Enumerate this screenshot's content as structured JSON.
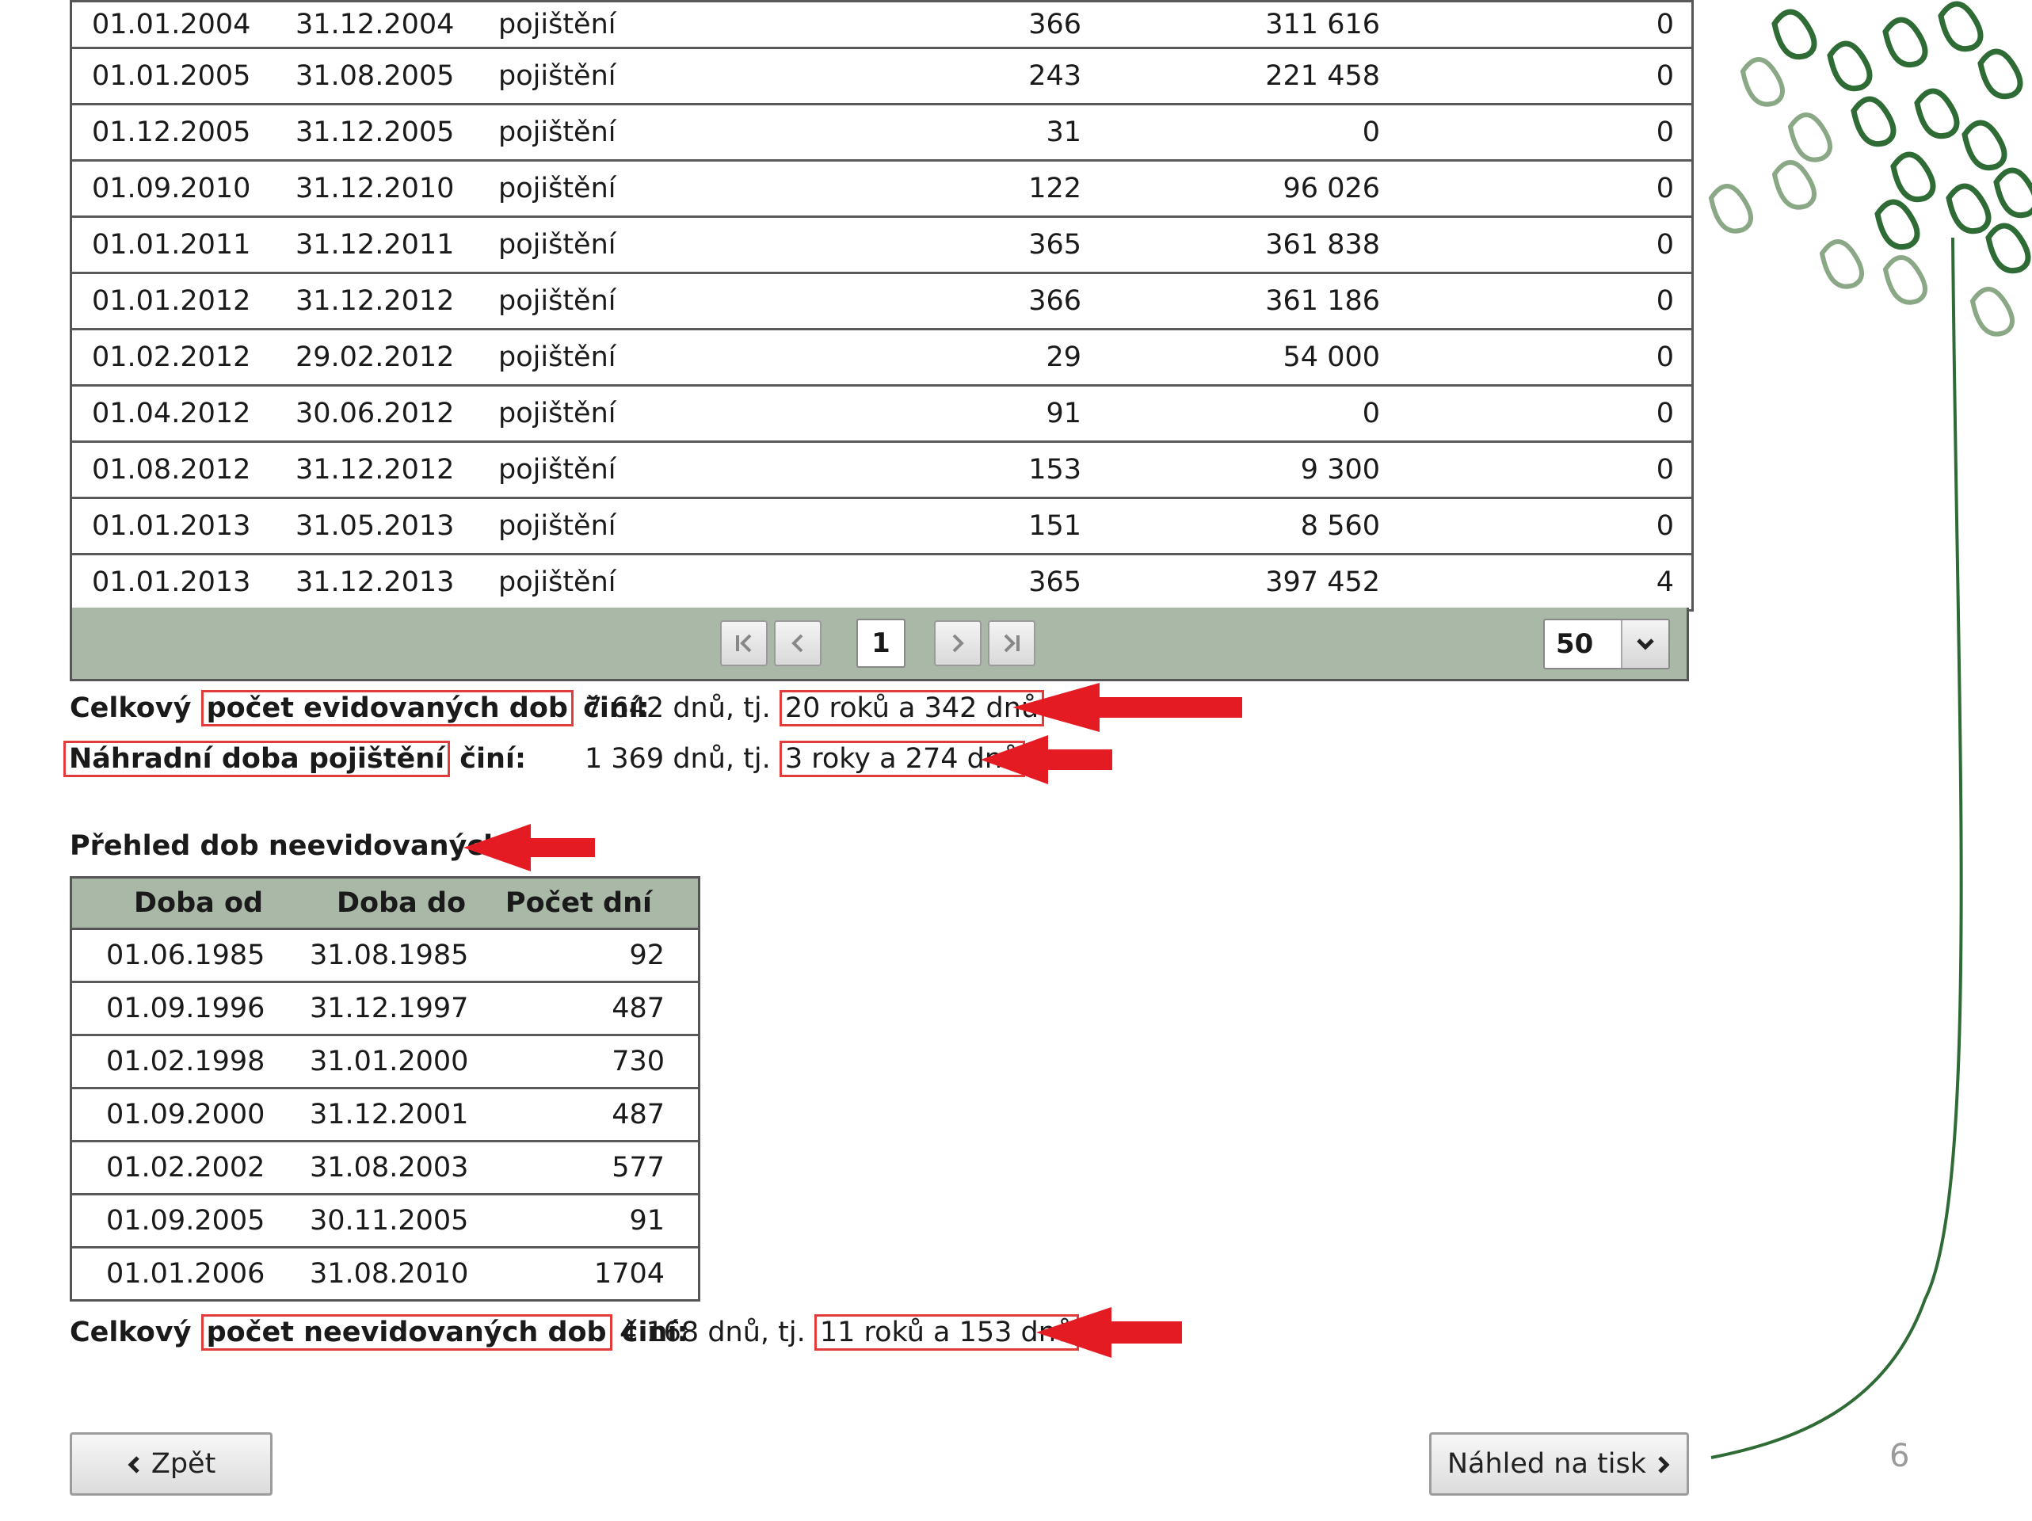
{
  "top_table": {
    "rows": [
      {
        "from": "01.01.2004",
        "to": "31.12.2004",
        "type": "pojištění",
        "days": "366",
        "income": "311 616",
        "z": "0"
      },
      {
        "from": "01.01.2005",
        "to": "31.08.2005",
        "type": "pojištění",
        "days": "243",
        "income": "221 458",
        "z": "0"
      },
      {
        "from": "01.12.2005",
        "to": "31.12.2005",
        "type": "pojištění",
        "days": "31",
        "income": "0",
        "z": "0"
      },
      {
        "from": "01.09.2010",
        "to": "31.12.2010",
        "type": "pojištění",
        "days": "122",
        "income": "96 026",
        "z": "0"
      },
      {
        "from": "01.01.2011",
        "to": "31.12.2011",
        "type": "pojištění",
        "days": "365",
        "income": "361 838",
        "z": "0"
      },
      {
        "from": "01.01.2012",
        "to": "31.12.2012",
        "type": "pojištění",
        "days": "366",
        "income": "361 186",
        "z": "0"
      },
      {
        "from": "01.02.2012",
        "to": "29.02.2012",
        "type": "pojištění",
        "days": "29",
        "income": "54 000",
        "z": "0"
      },
      {
        "from": "01.04.2012",
        "to": "30.06.2012",
        "type": "pojištění",
        "days": "91",
        "income": "0",
        "z": "0"
      },
      {
        "from": "01.08.2012",
        "to": "31.12.2012",
        "type": "pojištění",
        "days": "153",
        "income": "9 300",
        "z": "0"
      },
      {
        "from": "01.01.2013",
        "to": "31.05.2013",
        "type": "pojištění",
        "days": "151",
        "income": "8 560",
        "z": "0"
      },
      {
        "from": "01.01.2013",
        "to": "31.12.2013",
        "type": "pojištění",
        "days": "365",
        "income": "397 452",
        "z": "4"
      }
    ]
  },
  "pager": {
    "current_page": "1",
    "page_size": "50",
    "icons": [
      "first-page-icon",
      "prev-page-icon",
      "next-page-icon",
      "last-page-icon",
      "chevron-down-icon"
    ]
  },
  "summary": {
    "evidovane_prefix": "Celkový ",
    "evidovane_highlight": "počet evidovaných dob",
    "evidovane_suffix": " činí:",
    "evidovane_value": "7 642 dnů, tj. ",
    "evidovane_years": "20 roků a 342 dnů",
    "nahradni_highlight": "Náhradní doba pojištění",
    "nahradni_suffix": " činí:",
    "nahradni_value": "1 369 dnů, tj. ",
    "nahradni_years": "3 roky a 274 dnů"
  },
  "neevidovane": {
    "title": "Přehled dob neevidovaných",
    "headers": {
      "from": "Doba od",
      "to": "Doba do",
      "count": "Počet dní"
    },
    "rows": [
      {
        "from": "01.06.1985",
        "to": "31.08.1985",
        "count": "92"
      },
      {
        "from": "01.09.1996",
        "to": "31.12.1997",
        "count": "487"
      },
      {
        "from": "01.02.1998",
        "to": "31.01.2000",
        "count": "730"
      },
      {
        "from": "01.09.2000",
        "to": "31.12.2001",
        "count": "487"
      },
      {
        "from": "01.02.2002",
        "to": "31.08.2003",
        "count": "577"
      },
      {
        "from": "01.09.2005",
        "to": "30.11.2005",
        "count": "91"
      },
      {
        "from": "01.01.2006",
        "to": "31.08.2010",
        "count": "1704"
      }
    ],
    "total_prefix": "Celkový ",
    "total_highlight": "počet neevidovaných dob",
    "total_suffix": " činí:",
    "total_value": "4 168 dnů, tj. ",
    "total_years": "11 roků a 153 dnů"
  },
  "buttons": {
    "back": "Zpět",
    "print_preview": "Náhled na tisk"
  },
  "slide": {
    "page_number": "6"
  },
  "colors": {
    "header_green": "#a9b8a7",
    "highlight_red": "#e23b3b",
    "tree_green": "#2e6b35"
  }
}
